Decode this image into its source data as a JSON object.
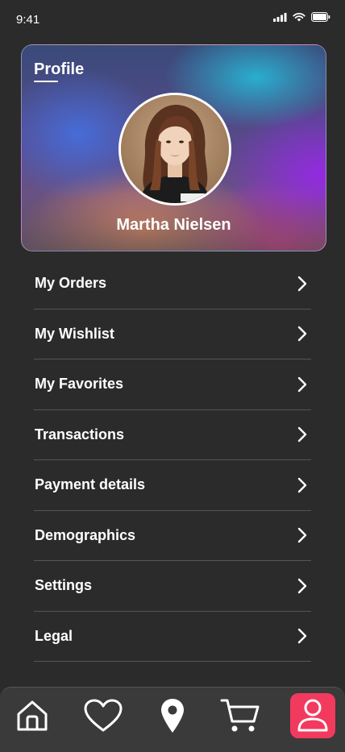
{
  "status_bar": {
    "time": "9:41"
  },
  "profile": {
    "title": "Profile",
    "name": "Martha Nielsen"
  },
  "menu": [
    {
      "label": "My Orders"
    },
    {
      "label": "My Wishlist"
    },
    {
      "label": "My Favorites"
    },
    {
      "label": "Transactions"
    },
    {
      "label": "Payment details"
    },
    {
      "label": "Demographics"
    },
    {
      "label": "Settings"
    },
    {
      "label": "Legal"
    }
  ],
  "tab_bar": {
    "items": [
      {
        "icon": "home-icon"
      },
      {
        "icon": "heart-icon"
      },
      {
        "icon": "location-icon"
      },
      {
        "icon": "cart-icon"
      },
      {
        "icon": "user-icon",
        "active": true
      }
    ],
    "active_color": "#f23a5e"
  }
}
